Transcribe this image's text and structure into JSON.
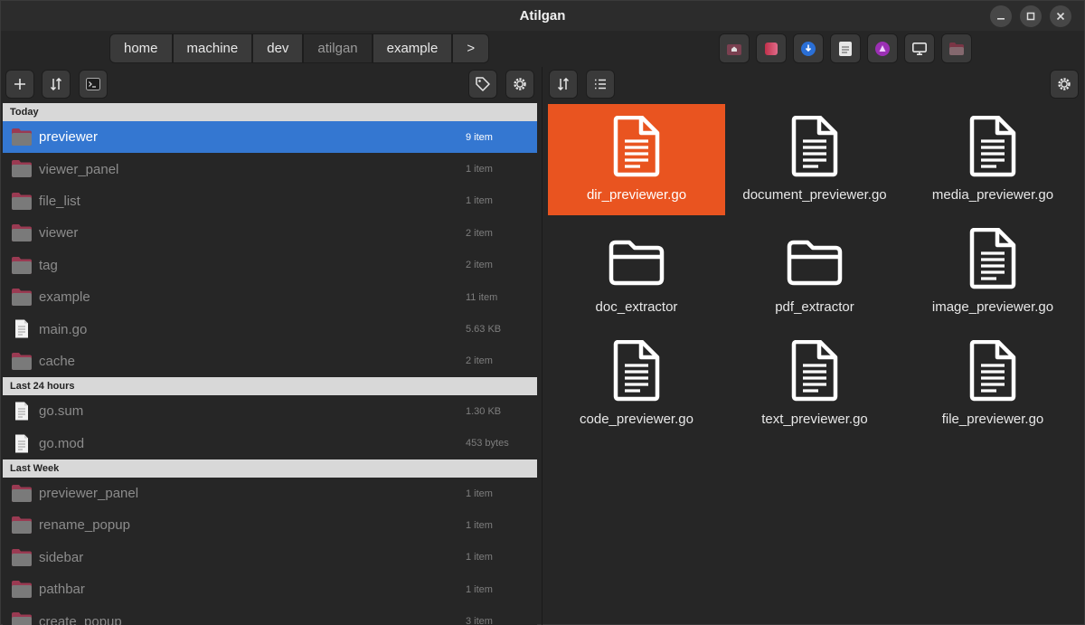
{
  "window": {
    "title": "Atilgan"
  },
  "pathbar": {
    "crumbs": [
      "home",
      "machine",
      "dev",
      "atilgan",
      "example",
      ">"
    ],
    "favorites": [
      {
        "name": "home-folder-icon",
        "color": "#8a4a5a"
      },
      {
        "name": "gradient-app-icon",
        "color": "#c0304a"
      },
      {
        "name": "download-icon",
        "color": "#2a6fd6"
      },
      {
        "name": "document-icon",
        "color": "#e6e6e6"
      },
      {
        "name": "purple-app-icon",
        "color": "#9b2fb4"
      },
      {
        "name": "monitor-icon",
        "color": "#e6e6e6"
      },
      {
        "name": "red-folder-icon",
        "color": "#8a3a4a"
      }
    ]
  },
  "left": {
    "groups": [
      {
        "title": "Today",
        "items": [
          {
            "name": "previewer",
            "meta": "9 item",
            "type": "folder",
            "selected": true
          },
          {
            "name": "viewer_panel",
            "meta": "1 item",
            "type": "folder"
          },
          {
            "name": "file_list",
            "meta": "1 item",
            "type": "folder"
          },
          {
            "name": "viewer",
            "meta": "2 item",
            "type": "folder"
          },
          {
            "name": "tag",
            "meta": "2 item",
            "type": "folder"
          },
          {
            "name": "example",
            "meta": "11 item",
            "type": "folder"
          },
          {
            "name": "main.go",
            "meta": "5.63 KB",
            "type": "file"
          },
          {
            "name": "cache",
            "meta": "2 item",
            "type": "folder"
          }
        ]
      },
      {
        "title": "Last 24 hours",
        "items": [
          {
            "name": "go.sum",
            "meta": "1.30 KB",
            "type": "file"
          },
          {
            "name": "go.mod",
            "meta": "453 bytes",
            "type": "file"
          }
        ]
      },
      {
        "title": "Last Week",
        "items": [
          {
            "name": "previewer_panel",
            "meta": "1 item",
            "type": "folder"
          },
          {
            "name": "rename_popup",
            "meta": "1 item",
            "type": "folder"
          },
          {
            "name": "sidebar",
            "meta": "1 item",
            "type": "folder"
          },
          {
            "name": "pathbar",
            "meta": "1 item",
            "type": "folder"
          },
          {
            "name": "create_popup",
            "meta": "3 item",
            "type": "folder"
          }
        ]
      }
    ]
  },
  "right": {
    "items": [
      {
        "name": "dir_previewer.go",
        "type": "file",
        "selected": true
      },
      {
        "name": "document_previewer.go",
        "type": "file"
      },
      {
        "name": "media_previewer.go",
        "type": "file"
      },
      {
        "name": "doc_extractor",
        "type": "folder"
      },
      {
        "name": "pdf_extractor",
        "type": "folder"
      },
      {
        "name": "image_previewer.go",
        "type": "file"
      },
      {
        "name": "code_previewer.go",
        "type": "file"
      },
      {
        "name": "text_previewer.go",
        "type": "file"
      },
      {
        "name": "file_previewer.go",
        "type": "file"
      }
    ]
  },
  "colors": {
    "accent": "#e95420",
    "selection": "#3477d1"
  }
}
